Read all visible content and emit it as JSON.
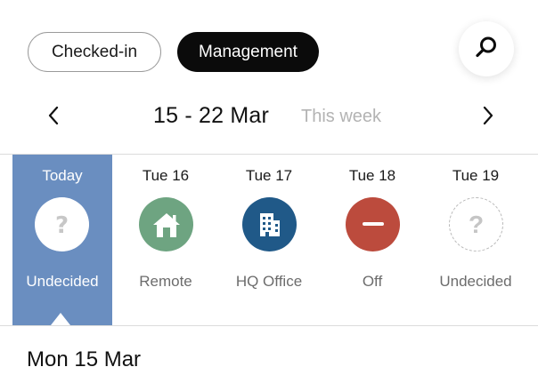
{
  "tabs": {
    "checked_in": "Checked-in",
    "management": "Management"
  },
  "week": {
    "range": "15 - 22 Mar",
    "label": "This week"
  },
  "days": [
    {
      "name": "Today",
      "status": "Undecided",
      "icon": "question-icon",
      "selected": true
    },
    {
      "name": "Tue 16",
      "status": "Remote",
      "icon": "home-icon",
      "color": "#6ea481"
    },
    {
      "name": "Tue 17",
      "status": "HQ Office",
      "icon": "building-icon",
      "color": "#205988"
    },
    {
      "name": "Tue 18",
      "status": "Off",
      "icon": "minus-icon",
      "color": "#bc4b3d"
    },
    {
      "name": "Tue 19",
      "status": "Undecided",
      "icon": "question-icon"
    }
  ],
  "selected_date_heading": "Mon 15 Mar",
  "colors": {
    "selected_day_bg": "#6a8ec0",
    "remote": "#6ea481",
    "office": "#205988",
    "off": "#bc4b3d"
  }
}
